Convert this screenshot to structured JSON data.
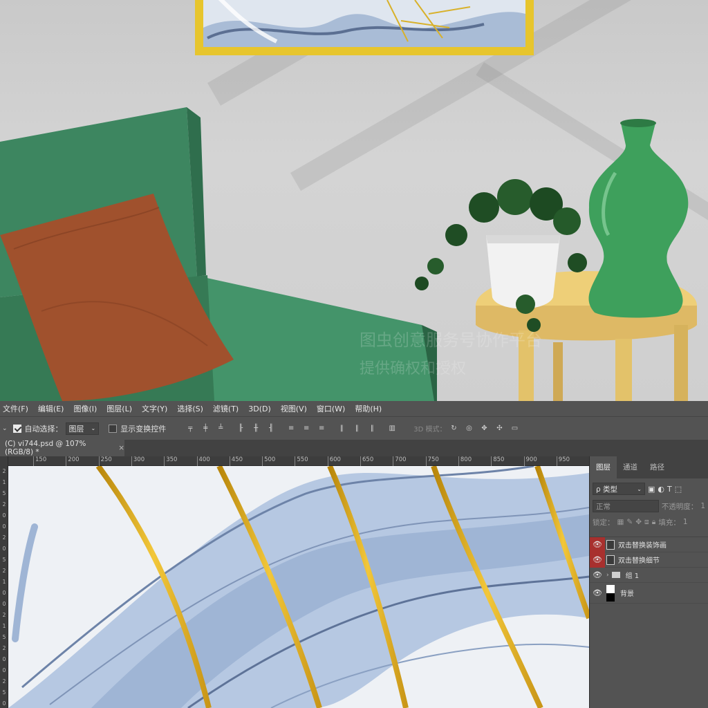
{
  "menu": [
    "文件(F)",
    "编辑(E)",
    "图像(I)",
    "图层(L)",
    "文字(Y)",
    "选择(S)",
    "滤镜(T)",
    "3D(D)",
    "视图(V)",
    "窗口(W)",
    "帮助(H)"
  ],
  "options": {
    "auto_select_label": "自动选择：",
    "auto_select_value": "图层",
    "show_transform_label": "显示变换控件",
    "mode_3d_label": "3D 模式："
  },
  "doc_tab": {
    "title": "(C) vi744.psd @ 107%(RGB/8) *",
    "close": "×"
  },
  "ruler": {
    "h_ticks": [
      "150",
      "200",
      "250",
      "300",
      "350",
      "400",
      "450",
      "500",
      "550",
      "600",
      "650",
      "700",
      "750",
      "800",
      "850",
      "900",
      "950"
    ],
    "v_ticks": [
      "2",
      "1",
      "5",
      "2",
      "0",
      "0",
      "2",
      "0",
      "5",
      "2",
      "1",
      "0",
      "0",
      "2",
      "1",
      "5",
      "2",
      "0",
      "0",
      "2",
      "5",
      "0"
    ]
  },
  "watermark": {
    "line1": "图虫创意服务号协作平台",
    "line2": "提供确权和授权"
  },
  "layers_panel": {
    "tabs": [
      "图层",
      "通道",
      "路径"
    ],
    "filter_label": "ρ 类型",
    "blend_mode": "正常",
    "opacity_label": "不透明度：",
    "opacity_value": "1",
    "lock_label": "锁定：",
    "fill_label": "填充：",
    "fill_value": "1",
    "layers": [
      {
        "name": "双击替换装饰画",
        "type": "smart",
        "eye_highlight": true
      },
      {
        "name": "双击替换细节",
        "type": "smart",
        "eye_highlight": true
      },
      {
        "name": "组 1",
        "type": "group",
        "eye_highlight": false
      },
      {
        "name": "背景",
        "type": "mask",
        "eye_highlight": false
      }
    ]
  },
  "colors": {
    "ps_panel": "#535353",
    "ps_dark": "#424242",
    "eye_highlight": "#a8302e",
    "sofa_green": "#3f8a60",
    "pillow_brown": "#a0512d",
    "table_yellow": "#e8c66c",
    "vase_green": "#3ea05c",
    "frame_gold": "#e7c52d",
    "gold_line": "#e0ae1c",
    "paint_blue": "#b6c8e2"
  }
}
